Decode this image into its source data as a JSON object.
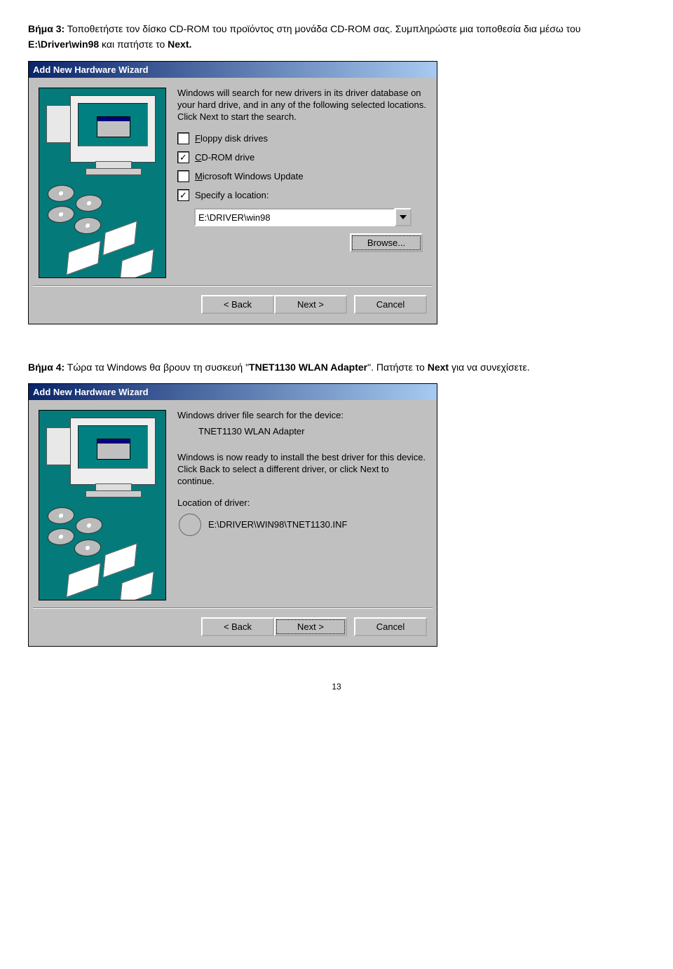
{
  "step3": {
    "label": "Βήμα 3:",
    "text_a": " Τοποθετήστε τον δίσκο CD-ROM του προϊόντος στη μονάδα CD-ROM σας. Συμπληρώστε μια τοποθεσία δια μέσω του ",
    "path": "E:\\Driver\\win98",
    "text_b": " και πατήστε το ",
    "next": "Next."
  },
  "wiz1": {
    "title": "Add New Hardware Wizard",
    "info": "Windows will search for new drivers in its driver database on your hard drive, and in any of the following selected locations. Click Next to start the search.",
    "opts": {
      "floppy": "Floppy disk drives",
      "cdrom": "CD-ROM drive",
      "msupdate": "Microsoft Windows Update",
      "specify": "Specify a location:"
    },
    "checks": {
      "floppy": "",
      "cdrom": "✓",
      "msupdate": "",
      "specify": "✓"
    },
    "path_value": "E:\\DRIVER\\win98",
    "browse": "Browse...",
    "back": "< Back",
    "next": "Next >",
    "cancel": "Cancel"
  },
  "step4": {
    "label": "Βήμα 4:",
    "text_a": " Τώρα τα Windows θα βρουν τη συσκευή \"",
    "device": "TNET1130 WLAN Adapter",
    "text_b": "\". Πατήστε το ",
    "next": "Next",
    "text_c": " για να συνεχίσετε."
  },
  "wiz2": {
    "title": "Add New Hardware Wizard",
    "line1": "Windows driver file search for the device:",
    "device": "TNET1130 WLAN Adapter",
    "line2": "Windows is now ready to install the best driver for this device. Click Back to select a different driver, or click Next to continue.",
    "loc_label": "Location of driver:",
    "loc_value": "E:\\DRIVER\\WIN98\\TNET1130.INF",
    "back": "< Back",
    "next": "Next >",
    "cancel": "Cancel"
  },
  "page_number": "13"
}
